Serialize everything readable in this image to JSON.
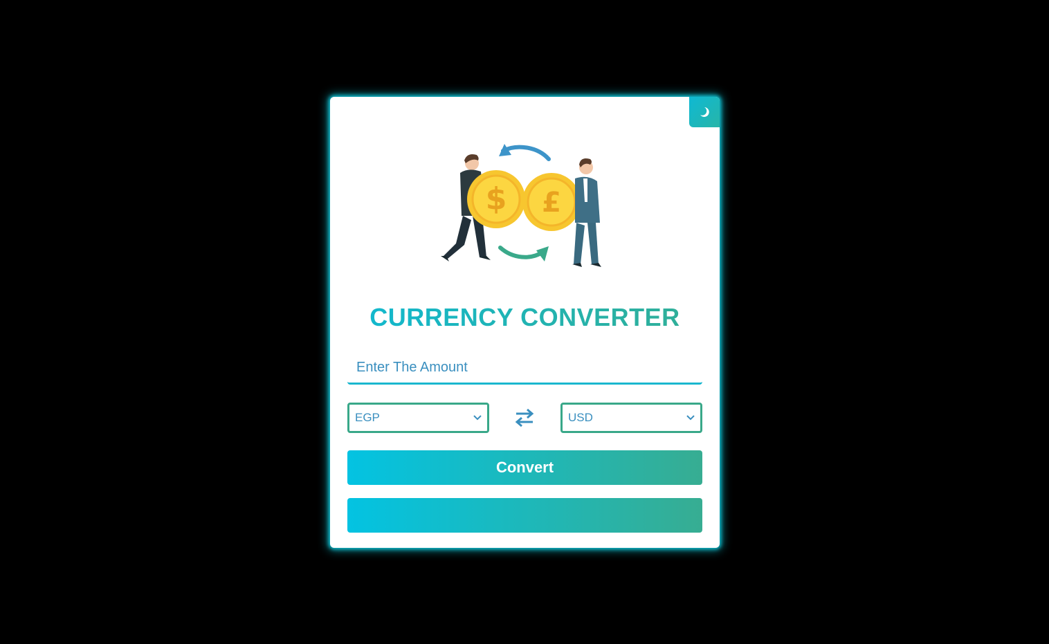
{
  "app": {
    "title": "CURRENCY CONVERTER"
  },
  "theme_toggle": {
    "icon": "moon-icon"
  },
  "illustration": {
    "icon": "currency-exchange-illustration",
    "coin_left_symbol": "$",
    "coin_right_symbol": "£"
  },
  "amount": {
    "placeholder": "Enter The Amount",
    "value": ""
  },
  "from_currency": {
    "selected": "EGP"
  },
  "to_currency": {
    "selected": "USD"
  },
  "swap": {
    "icon": "swap-arrows-icon"
  },
  "convert_button": {
    "label": "Convert"
  },
  "result": {
    "text": ""
  },
  "colors": {
    "background": "#000000",
    "card": "#ffffff",
    "accent_start": "#03c3e2",
    "accent_end": "#37ad92",
    "text_blue": "#3a8fbf",
    "glow": "#11c2d4"
  }
}
